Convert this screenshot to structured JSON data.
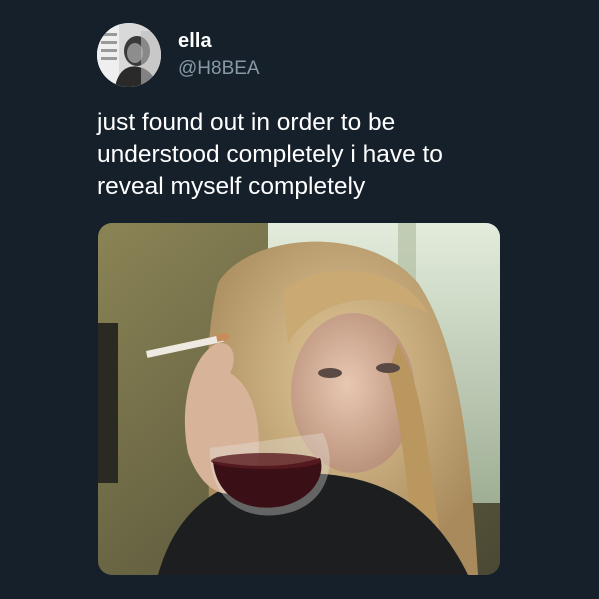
{
  "author": {
    "name": "ella",
    "handle": "@H8BEA",
    "avatar_icon": "profile-photo-avatar"
  },
  "tweet": {
    "lines": [
      "just found out in order to be",
      "understood completely i have to",
      "reveal myself completely"
    ]
  },
  "media": {
    "icon": "attached-photo",
    "colors": {
      "background_wall": "#6f6b4a",
      "window_light": "#cfdcc8",
      "hair": "#c9ae7e",
      "skin": "#d8b7a0",
      "wine": "#3a1016",
      "clothing": "#1c1e1f"
    }
  },
  "theme": {
    "background": "#15202b",
    "text_primary": "#ffffff",
    "text_secondary": "#8899a6"
  }
}
